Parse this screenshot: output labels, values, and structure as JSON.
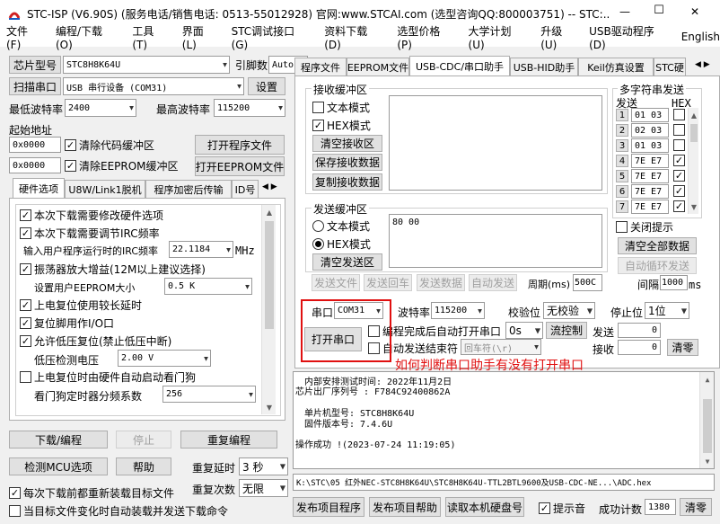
{
  "window": {
    "title": "STC-ISP (V6.90S) (服务电话/销售电话: 0513-55012928) 官网:www.STCAI.com  (选型咨询QQ:800003751) -- STC:...",
    "min": "—",
    "max": "☐",
    "close": "✕"
  },
  "menu": [
    "文件(F)",
    "编程/下载(O)",
    "工具(T)",
    "界面(L)",
    "STC调试接口(G)",
    "资料下载(D)",
    "选型价格(P)",
    "大学计划(U)",
    "升级(U)",
    "USB驱动程序(D)",
    "English"
  ],
  "left": {
    "chip_label": "芯片型号",
    "chip_value": "STC8H8K64U",
    "pin_label": "引脚数",
    "pin_value": "Auto",
    "scan_btn": "扫描串口",
    "port_value": "USB 串行设备 (COM31)",
    "settings_btn": "设置",
    "min_baud_label": "最低波特率",
    "min_baud": "2400",
    "max_baud_label": "最高波特率",
    "max_baud": "115200",
    "start_addr": "起始地址",
    "addr1": "0x0000",
    "clear_code": "清除代码缓冲区",
    "open_prog": "打开程序文件",
    "addr2": "0x0000",
    "clear_eeprom": "清除EEPROM缓冲区",
    "open_eeprom": "打开EEPROM文件",
    "tabs": [
      "硬件选项",
      "U8W/Link1脱机",
      "程序加密后传输",
      "ID号"
    ],
    "options": {
      "o1": "本次下载需要修改硬件选项",
      "o2": "本次下载需要调节IRC频率",
      "irc_label": "输入用户程序运行时的IRC频率",
      "irc_value": "22.1184",
      "irc_unit": "MHz",
      "o3": "振荡器放大增益(12M以上建议选择)",
      "eeprom_label": "设置用户EEPROM大小",
      "eeprom_value": "0.5 K",
      "o4": "上电复位使用较长延时",
      "o5": "复位脚用作I/O口",
      "o6": "允许低压复位(禁止低压中断)",
      "lvd_label": "低压检测电压",
      "lvd_value": "2.00 V",
      "o7": "上电复位时由硬件自动启动看门狗",
      "wdt_label": "看门狗定时器分频系数",
      "wdt_value": "256"
    },
    "download_btn": "下载/编程",
    "stop_btn": "停止",
    "reprog_btn": "重复编程",
    "detect_btn": "检测MCU选项",
    "help_btn": "帮助",
    "delay_label": "重复延时",
    "delay_value": "3 秒",
    "times_label": "重复次数",
    "times_value": "无限",
    "reload_each": "每次下载前都重新装载目标文件",
    "auto_reload": "当目标文件变化时自动装载并发送下载命令"
  },
  "right": {
    "tabs": [
      "程序文件",
      "EEPROM文件",
      "USB-CDC/串口助手",
      "USB-HID助手",
      "Keil仿真设置",
      "STC硬"
    ],
    "rx": {
      "title": "接收缓冲区",
      "text_mode": "文本模式",
      "hex_mode": "HEX模式",
      "clear": "清空接收区",
      "save": "保存接收数据",
      "copy": "复制接收数据"
    },
    "tx": {
      "title": "发送缓冲区",
      "text_mode": "文本模式",
      "hex_mode": "HEX模式",
      "clear": "清空发送区",
      "content": "80 00",
      "send_file": "发送文件",
      "send_return": "发送回车",
      "send_data": "发送数据",
      "auto_send": "自动发送",
      "period_label": "周期(ms)",
      "period_value": "500C"
    },
    "multi": {
      "title": "多字符串发送",
      "send_col": "发送",
      "hex_col": "HEX",
      "rows": [
        {
          "n": "1",
          "v": "01 03"
        },
        {
          "n": "2",
          "v": "02 03"
        },
        {
          "n": "3",
          "v": "01 03"
        },
        {
          "n": "4",
          "v": "7E E7"
        },
        {
          "n": "5",
          "v": "7E E7"
        },
        {
          "n": "6",
          "v": "7E E7"
        },
        {
          "n": "7",
          "v": "7E E7"
        }
      ],
      "close_hint": "关闭提示",
      "clear_all": "清空全部数据",
      "auto_loop": "自动循环发送",
      "interval_label": "间隔",
      "interval_value": "1000",
      "interval_unit": "ms"
    },
    "port_label": "串口",
    "port_value": "COM31",
    "baud_label": "波特率",
    "baud_value": "115200",
    "parity_label": "校验位",
    "parity_value": "无校验",
    "stop_label": "停止位",
    "stop_value": "1位",
    "open_btn": "打开串口",
    "auto_open": "编程完成后自动打开串口",
    "auto_open_delay": "0s",
    "flow_ctrl": "流控制",
    "auto_end": "自动发送结束符",
    "end_char": "回车符(\\r)",
    "send_label": "发送",
    "send_count": "0",
    "recv_label": "接收",
    "recv_count": "0",
    "clear_count": "清零",
    "annotation": "如何判断串口助手有没有打开串口",
    "log": {
      "l1": "内部安排测试时间: 2022年11月2日",
      "l2": "芯片出厂序列号 : F784C92400862A",
      "l3": "单片机型号: STC8H8K64U",
      "l4": "固件版本号: 7.4.6U",
      "l5": "操作成功 !(2023-07-24 11:19:05)"
    },
    "path": "K:\\STC\\05 红外NEC-STC8H8K64U\\STC8H8K64U-TTL2BTL9600及USB-CDC-NE...\\ADC.hex",
    "publish_btn": "发布项目程序",
    "publish_help": "发布项目帮助",
    "read_disk": "读取本机硬盘号",
    "beep": "提示音",
    "success_label": "成功计数",
    "success_value": "1380",
    "clear_success": "清零"
  }
}
